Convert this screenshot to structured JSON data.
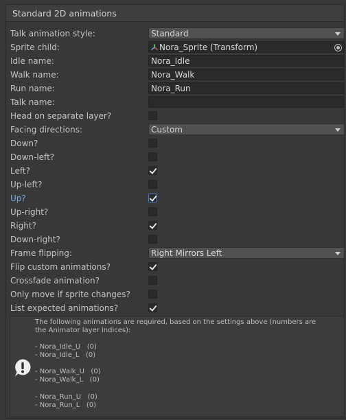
{
  "panel": {
    "title": "Standard 2D animations"
  },
  "fields": {
    "talk_style": {
      "label": "Talk animation style:",
      "value": "Standard"
    },
    "sprite_child": {
      "label": "Sprite child:",
      "value": "Nora_Sprite (Transform)"
    },
    "idle_name": {
      "label": "Idle name:",
      "value": "Nora_Idle"
    },
    "walk_name": {
      "label": "Walk name:",
      "value": "Nora_Walk"
    },
    "run_name": {
      "label": "Run name:",
      "value": "Nora_Run"
    },
    "talk_name": {
      "label": "Talk name:",
      "value": ""
    },
    "head_layer": {
      "label": "Head on separate layer?",
      "checked": false
    },
    "facing": {
      "label": "Facing directions:",
      "value": "Custom"
    },
    "down": {
      "label": "Down?",
      "checked": false
    },
    "down_left": {
      "label": "Down-left?",
      "checked": false
    },
    "left": {
      "label": "Left?",
      "checked": true
    },
    "up_left": {
      "label": "Up-left?",
      "checked": false
    },
    "up": {
      "label": "Up?",
      "checked": true
    },
    "up_right": {
      "label": "Up-right?",
      "checked": false
    },
    "right": {
      "label": "Right?",
      "checked": true
    },
    "down_right": {
      "label": "Down-right?",
      "checked": false
    },
    "frame_flipping": {
      "label": "Frame flipping:",
      "value": "Right Mirrors Left"
    },
    "flip_custom": {
      "label": "Flip custom animations?",
      "checked": true
    },
    "crossfade": {
      "label": "Crossfade animation?",
      "checked": false
    },
    "only_move": {
      "label": "Only move if sprite changes?",
      "checked": false
    },
    "list_expected": {
      "label": "List expected animations?",
      "checked": true
    }
  },
  "help": {
    "intro": "The following animations are required, based on the settings above (numbers are the Animator layer indices):",
    "lines": [
      "- Nora_Idle_U   (0)",
      "- Nora_Idle_L   (0)",
      "- Nora_Walk_U   (0)",
      "- Nora_Walk_L   (0)",
      "- Nora_Run_U   (0)",
      "- Nora_Run_L   (0)"
    ]
  },
  "icons": {
    "transform": "transform-icon",
    "picker": "object-picker-icon",
    "warning": "warning-icon",
    "dropdown": "dropdown-arrow-icon",
    "check": "checkmark-icon"
  },
  "colors": {
    "background": "#383838",
    "focus_label": "#7ba7e6",
    "focus_border": "#4c7fd0"
  }
}
